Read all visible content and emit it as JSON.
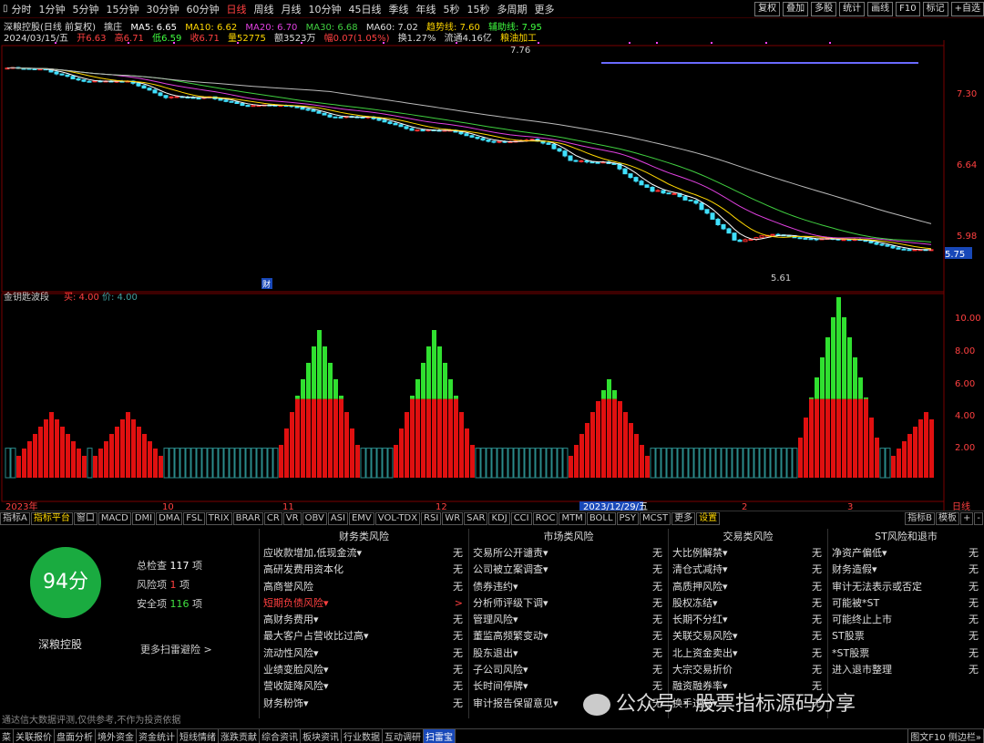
{
  "toolbar": {
    "periods": [
      "分时",
      "1分钟",
      "5分钟",
      "15分钟",
      "30分钟",
      "60分钟",
      "日线",
      "周线",
      "月线",
      "10分钟",
      "45日线",
      "季线",
      "年线",
      "5秒",
      "15秒",
      "多周期",
      "更多"
    ],
    "active": "日线",
    "right": [
      "复权",
      "叠加",
      "多股",
      "统计",
      "画线",
      "F10",
      "标记",
      "+自选"
    ]
  },
  "info": {
    "name": "深粮控股(日线 前复权)",
    "indicator": "擒庄",
    "ma5": "MA5: 6.65",
    "ma10": "MA10: 6.62",
    "ma20": "MA20: 6.70",
    "ma30": "MA30: 6.68",
    "ma60": "MA60: 7.02",
    "trend": "趋势线: 7.60",
    "aux": "辅助线: 7.95",
    "date": "2024/03/15/五",
    "open": "开6.63",
    "high": "高6.71",
    "low": "低6.59",
    "close": "收6.71",
    "vol": "量52775",
    "amt": "额3523万",
    "chg": "幅0.07(1.05%)",
    "turn": "换1.27%",
    "float": "流通4.16亿",
    "concept": "粮油加工"
  },
  "price_axis": [
    "7.30",
    "6.64",
    "5.98",
    "5.75"
  ],
  "annotations": {
    "high": "7.76",
    "low": "5.61",
    "fin": "财"
  },
  "osc": {
    "title": "金钥匙波段",
    "v1": "买: 4.00",
    "v2": "价: 4.00",
    "axis": [
      "10.00",
      "8.00",
      "6.00",
      "4.00",
      "2.00"
    ]
  },
  "time_axis": [
    "2023年",
    "10",
    "11",
    "12",
    "2023/12/29/五",
    "2",
    "3",
    "日线"
  ],
  "indicator_tabs": [
    "指标A",
    "指标平台",
    "窗口",
    "MACD",
    "DMI",
    "DMA",
    "FSL",
    "TRIX",
    "BRAR",
    "CR",
    "VR",
    "OBV",
    "ASI",
    "EMV",
    "VOL-TDX",
    "RSI",
    "WR",
    "SAR",
    "KDJ",
    "CCI",
    "ROC",
    "MTM",
    "BOLL",
    "PSY",
    "MCST",
    "更多",
    "设置"
  ],
  "indicator_right": [
    "指标B",
    "模板",
    "+",
    "-"
  ],
  "scan": {
    "score": "94分",
    "stock": "深粮控股",
    "total_label": "总检查",
    "total": "117",
    "risk_label": "风险项",
    "risk": "1",
    "safe_label": "安全项",
    "safe": "116",
    "unit": "项",
    "more": "更多扫雷避险 >",
    "disclaimer": "通达信大数据评测,仅供参考,不作为投资依据"
  },
  "columns": [
    {
      "title": "财务类风险",
      "rows": [
        [
          "应收款增加,低现金流▾",
          "无"
        ],
        [
          "高研发费用资本化",
          "无"
        ],
        [
          "高商誉风险",
          "无"
        ],
        [
          "短期负债风险▾",
          ">"
        ],
        [
          "高财务费用▾",
          "无"
        ],
        [
          "最大客户占营收比过高▾",
          "无"
        ],
        [
          "流动性风险▾",
          "无"
        ],
        [
          "业绩变脸风险▾",
          "无"
        ],
        [
          "营收陡降风险▾",
          "无"
        ],
        [
          "财务粉饰▾",
          "无"
        ]
      ]
    },
    {
      "title": "市场类风险",
      "rows": [
        [
          "交易所公开谴责▾",
          "无"
        ],
        [
          "公司被立案调查▾",
          "无"
        ],
        [
          "债券违约▾",
          "无"
        ],
        [
          "分析师评级下调▾",
          "无"
        ],
        [
          "管理风险▾",
          "无"
        ],
        [
          "董监高频繁变动▾",
          "无"
        ],
        [
          "股东退出▾",
          "无"
        ],
        [
          "子公司风险▾",
          "无"
        ],
        [
          "长时间停牌▾",
          "无"
        ],
        [
          "审计报告保留意见▾",
          "无"
        ]
      ]
    },
    {
      "title": "交易类风险",
      "rows": [
        [
          "大比例解禁▾",
          "无"
        ],
        [
          "清仓式减持▾",
          "无"
        ],
        [
          "高质押风险▾",
          "无"
        ],
        [
          "股权冻结▾",
          "无"
        ],
        [
          "长期不分红▾",
          "无"
        ],
        [
          "关联交易风险▾",
          "无"
        ],
        [
          "北上资金卖出▾",
          "无"
        ],
        [
          "大宗交易折价",
          "无"
        ],
        [
          "融资融券率▾",
          "无"
        ],
        [
          "换手过高▾",
          "无"
        ]
      ]
    },
    {
      "title": "ST风险和退市",
      "rows": [
        [
          "净资产偏低▾",
          "无"
        ],
        [
          "财务造假▾",
          "无"
        ],
        [
          "审计无法表示或否定",
          "无"
        ],
        [
          "可能被*ST",
          "无"
        ],
        [
          "可能终止上市",
          "无"
        ],
        [
          "ST股票",
          "无"
        ],
        [
          "*ST股票",
          "无"
        ],
        [
          "进入退市整理",
          "无"
        ]
      ]
    }
  ],
  "watermark": "公众号 · 股票指标源码分享",
  "bottom_tabs": [
    "菜",
    "关联报价",
    "盘面分析",
    "境外资金",
    "资金统计",
    "短线情绪",
    "涨跌贡献",
    "综合资讯",
    "板块资讯",
    "行业数据",
    "互动调研",
    "扫雷宝"
  ],
  "bottom_active": "扫雷宝",
  "bottom_right": "图文F10 侧边栏»"
}
